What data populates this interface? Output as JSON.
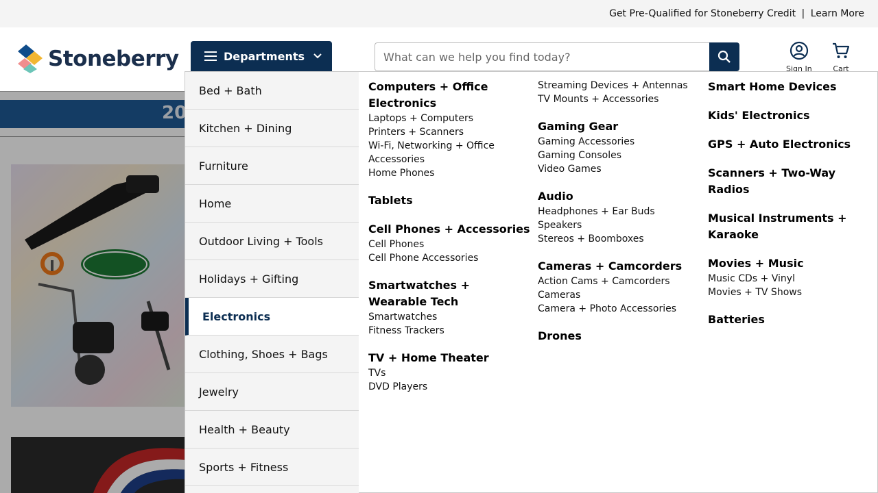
{
  "topbar": {
    "prequal": "Get Pre-Qualified for Stoneberry Credit",
    "separator": "|",
    "learn_more": "Learn More"
  },
  "header": {
    "logo_text": "Stoneberry",
    "departments_label": "Departments",
    "search_placeholder": "What can we help you find today?",
    "sign_in_label": "Sign In",
    "cart_label": "Cart"
  },
  "page": {
    "banner_text": "20"
  },
  "menu": {
    "departments": [
      "Bed + Bath",
      "Kitchen + Dining",
      "Furniture",
      "Home",
      "Outdoor Living + Tools",
      "Holidays + Gifting",
      "Electronics",
      "Clothing, Shoes + Bags",
      "Jewelry",
      "Health + Beauty",
      "Sports + Fitness"
    ],
    "active": "Electronics",
    "columns": [
      [
        {
          "title": "Computers + Office Electronics",
          "links": [
            "Laptops + Computers",
            "Printers + Scanners",
            "Wi-Fi, Networking + Office Accessories",
            "Home Phones"
          ]
        },
        {
          "title": "Tablets",
          "links": []
        },
        {
          "title": "Cell Phones + Accessories",
          "links": [
            "Cell Phones",
            "Cell Phone Accessories"
          ]
        },
        {
          "title": "Smartwatches + Wearable Tech",
          "links": [
            "Smartwatches",
            "Fitness Trackers"
          ]
        },
        {
          "title": "TV + Home Theater",
          "links": [
            "TVs",
            "DVD Players"
          ]
        }
      ],
      [
        {
          "title": "",
          "links": [
            "Streaming Devices + Antennas",
            "TV Mounts + Accessories"
          ]
        },
        {
          "title": "Gaming Gear",
          "links": [
            "Gaming Accessories",
            "Gaming Consoles",
            "Video Games"
          ]
        },
        {
          "title": "Audio",
          "links": [
            "Headphones + Ear Buds",
            "Speakers",
            "Stereos + Boomboxes"
          ]
        },
        {
          "title": "Cameras + Camcorders",
          "links": [
            "Action Cams + Camcorders",
            "Cameras",
            "Camera + Photo Accessories"
          ]
        },
        {
          "title": "Drones",
          "links": []
        }
      ],
      [
        {
          "title": "Smart Home Devices",
          "links": []
        },
        {
          "title": "Kids' Electronics",
          "links": []
        },
        {
          "title": "GPS + Auto Electronics",
          "links": []
        },
        {
          "title": "Scanners + Two-Way Radios",
          "links": []
        },
        {
          "title": "Musical Instruments + Karaoke",
          "links": []
        },
        {
          "title": "Movies + Music",
          "links": [
            "Music CDs + Vinyl",
            "Movies + TV Shows"
          ]
        },
        {
          "title": "Batteries",
          "links": []
        }
      ]
    ]
  },
  "colors": {
    "navy": "#0c2e52",
    "banner_blue": "#1e5a96",
    "menu_bg": "#f4f4f4"
  }
}
